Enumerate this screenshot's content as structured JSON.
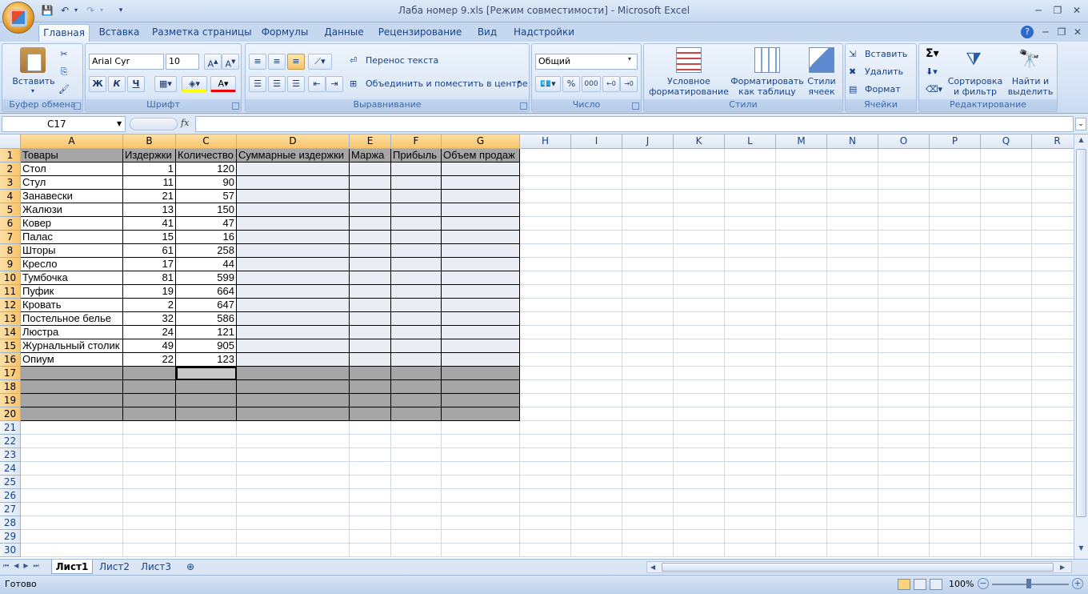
{
  "window": {
    "title": "Лаба номер 9.xls  [Режим совместимости] - Microsoft Excel"
  },
  "tabs": [
    "Главная",
    "Вставка",
    "Разметка страницы",
    "Формулы",
    "Данные",
    "Рецензирование",
    "Вид",
    "Надстройки"
  ],
  "ribbon": {
    "clipboard": {
      "label": "Буфер обмена",
      "paste": "Вставить"
    },
    "font": {
      "label": "Шрифт",
      "name": "Arial Cyr",
      "size": "10",
      "bold": "Ж",
      "italic": "К",
      "underline": "Ч"
    },
    "alignment": {
      "label": "Выравнивание",
      "wrap": "Перенос текста",
      "merge": "Объединить и поместить в центре"
    },
    "number": {
      "label": "Число",
      "format": "Общий",
      "percent": "%",
      "thousands": "000"
    },
    "styles": {
      "label": "Стили",
      "cond1": "Условное",
      "cond2": "форматирование",
      "table1": "Форматировать",
      "table2": "как таблицу",
      "cell1": "Стили",
      "cell2": "ячеек"
    },
    "cells": {
      "label": "Ячейки",
      "insert": "Вставить",
      "delete": "Удалить",
      "format": "Формат"
    },
    "editing": {
      "label": "Редактирование",
      "sort1": "Сортировка",
      "sort2": "и фильтр",
      "find1": "Найти и",
      "find2": "выделить"
    }
  },
  "formula": {
    "name_box": "C17",
    "fx": "fx",
    "value": ""
  },
  "columns": [
    "A",
    "B",
    "C",
    "D",
    "E",
    "F",
    "G",
    "H",
    "I",
    "J",
    "K",
    "L",
    "M",
    "N",
    "O",
    "P",
    "Q",
    "R"
  ],
  "headers": [
    "Товары",
    "Издержки",
    "Количество",
    "Суммарные издержки",
    "Маржа",
    "Прибыль",
    "Объем продаж"
  ],
  "rows": [
    [
      "Стол",
      "1",
      "120"
    ],
    [
      "Стул",
      "11",
      "90"
    ],
    [
      "Занавески",
      "21",
      "57"
    ],
    [
      "Жалюзи",
      "13",
      "150"
    ],
    [
      "Ковер",
      "41",
      "47"
    ],
    [
      "Палас",
      "15",
      "16"
    ],
    [
      "Шторы",
      "61",
      "258"
    ],
    [
      "Кресло",
      "17",
      "44"
    ],
    [
      "Тумбочка",
      "81",
      "599"
    ],
    [
      "Пуфик",
      "19",
      "664"
    ],
    [
      "Кровать",
      "2",
      "647"
    ],
    [
      "Постельное белье",
      "32",
      "586"
    ],
    [
      "Люстра",
      "24",
      "121"
    ],
    [
      "Журнальный столик",
      "49",
      "905"
    ],
    [
      "Опиум",
      "22",
      "123"
    ]
  ],
  "row_count": 30,
  "sheets": [
    "Лист1",
    "Лист2",
    "Лист3"
  ],
  "status": {
    "ready": "Готово",
    "zoom": "100%"
  },
  "colors": {
    "accent": "#15428b",
    "header_fill": "#a6a6a6",
    "empty_fill": "#ebedf4",
    "selected_header": "#f9c46a"
  }
}
